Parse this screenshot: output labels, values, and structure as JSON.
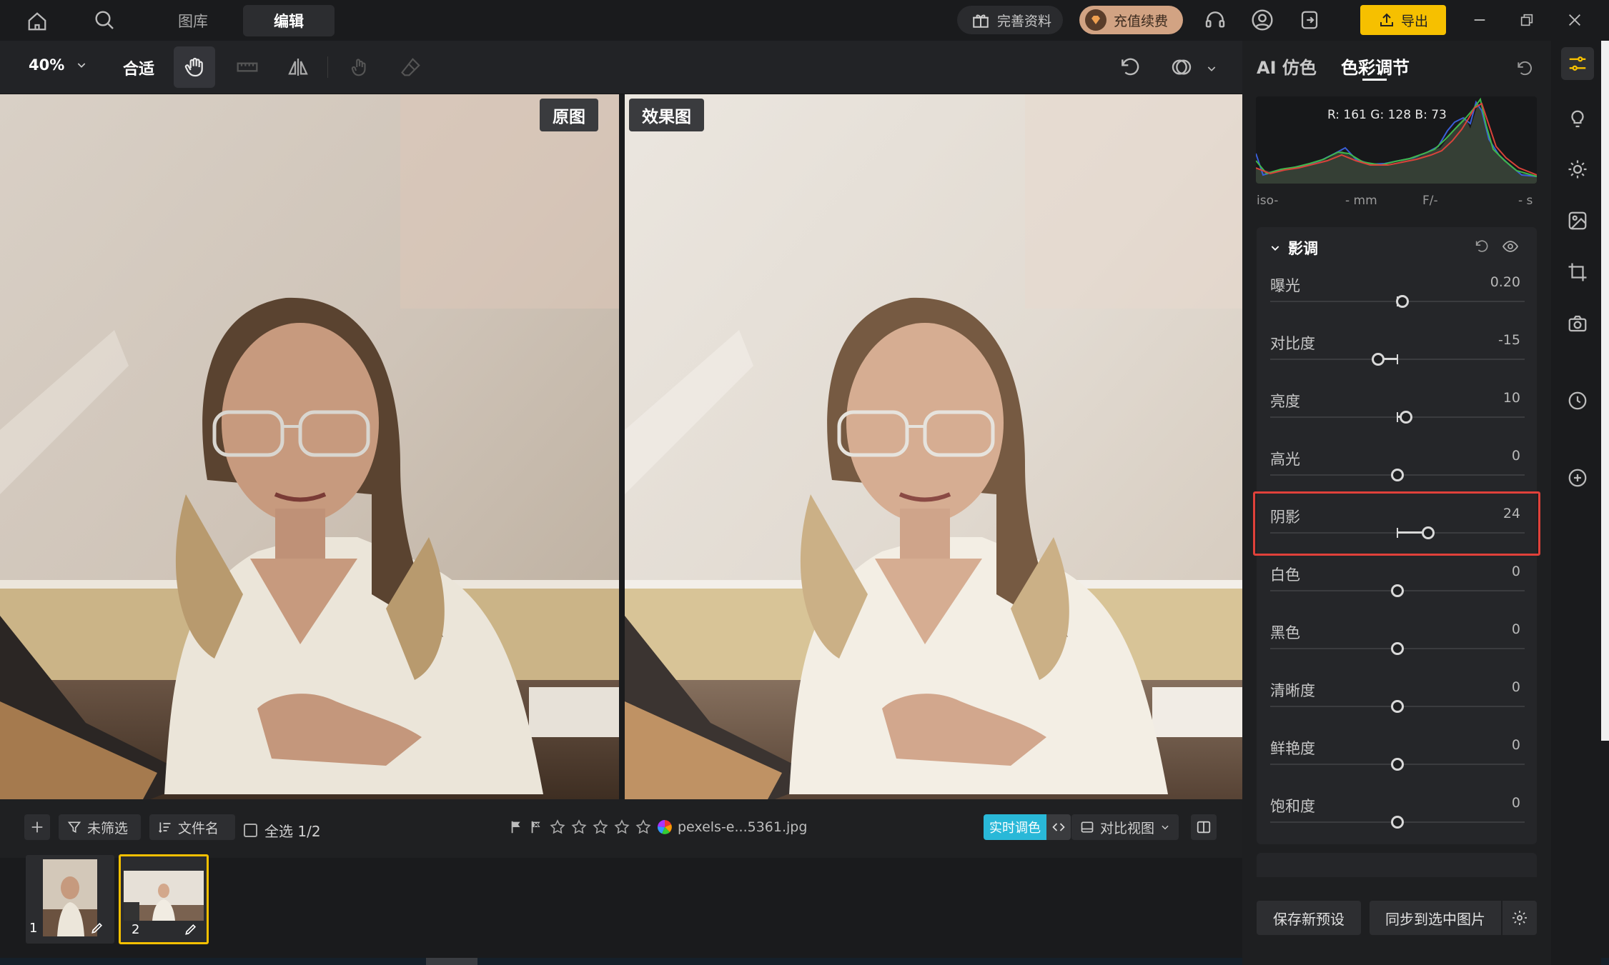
{
  "topbar": {
    "tabs": [
      {
        "label": "图库"
      },
      {
        "label": "编辑"
      }
    ],
    "complete_info": "完善资料",
    "recharge": "充值续费",
    "export": "导出"
  },
  "toolbar": {
    "zoom": "40%",
    "fit": "合适"
  },
  "viewer": {
    "original_label": "原图",
    "effect_label": "效果图"
  },
  "bottom": {
    "filter_label": "未筛选",
    "sort_label": "文件名",
    "select_all": "全选 1/2",
    "filename": "pexels-e...5361.jpg",
    "live_tone": "实时调色",
    "view_mode": "对比视图"
  },
  "filmstrip": [
    {
      "index": "1"
    },
    {
      "index": "2"
    }
  ],
  "panel": {
    "tab_ai": "AI 仿色",
    "tab_color": "色彩调节",
    "rgb": "R: 161  G: 128  B: 73",
    "meta": {
      "iso": "iso-",
      "mm": "- mm",
      "f": "F/-",
      "s": "- s"
    },
    "section_title": "影调",
    "sliders": [
      {
        "label": "曝光",
        "value": "0.20",
        "pos": 0.52
      },
      {
        "label": "对比度",
        "value": "-15",
        "pos": 0.425
      },
      {
        "label": "亮度",
        "value": "10",
        "pos": 0.535
      },
      {
        "label": "高光",
        "value": "0",
        "pos": 0.5
      },
      {
        "label": "阴影",
        "value": "24",
        "pos": 0.62
      },
      {
        "label": "白色",
        "value": "0",
        "pos": 0.5
      },
      {
        "label": "黑色",
        "value": "0",
        "pos": 0.5
      },
      {
        "label": "清晰度",
        "value": "0",
        "pos": 0.5
      },
      {
        "label": "鲜艳度",
        "value": "0",
        "pos": 0.5
      },
      {
        "label": "饱和度",
        "value": "0",
        "pos": 0.5
      }
    ],
    "save_preset": "保存新预设",
    "sync": "同步到选中图片"
  },
  "colors": {
    "accent": "#f6c000",
    "highlight": "#e0413a",
    "live": "#29b8d8"
  }
}
